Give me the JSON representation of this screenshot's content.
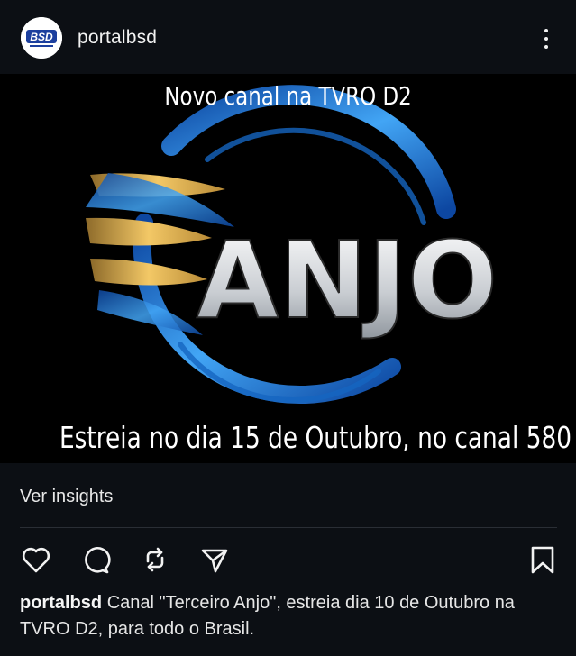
{
  "post": {
    "username": "portalbsd",
    "avatar_text": "BSD",
    "image": {
      "top_text": "Novo canal na TVRO D2",
      "logo_text": "ANJO",
      "bottom_text": "Estreia no dia 15 de Outubro, no canal 580"
    },
    "insights_label": "Ver insights",
    "caption_user": "portalbsd",
    "caption_text": "Canal \"Terceiro Anjo\", estreia dia 10 de Outubro na TVRO D2, para todo o Brasil."
  },
  "icons": {
    "like": "heart-icon",
    "comment": "comment-icon",
    "repost": "repost-icon",
    "share": "send-icon",
    "save": "bookmark-icon",
    "more": "more-vertical-icon"
  },
  "colors": {
    "background": "#0c0f14",
    "text": "#f5f5f5",
    "logo_blue": "#1e88e5",
    "logo_gold": "#e0a93a"
  }
}
